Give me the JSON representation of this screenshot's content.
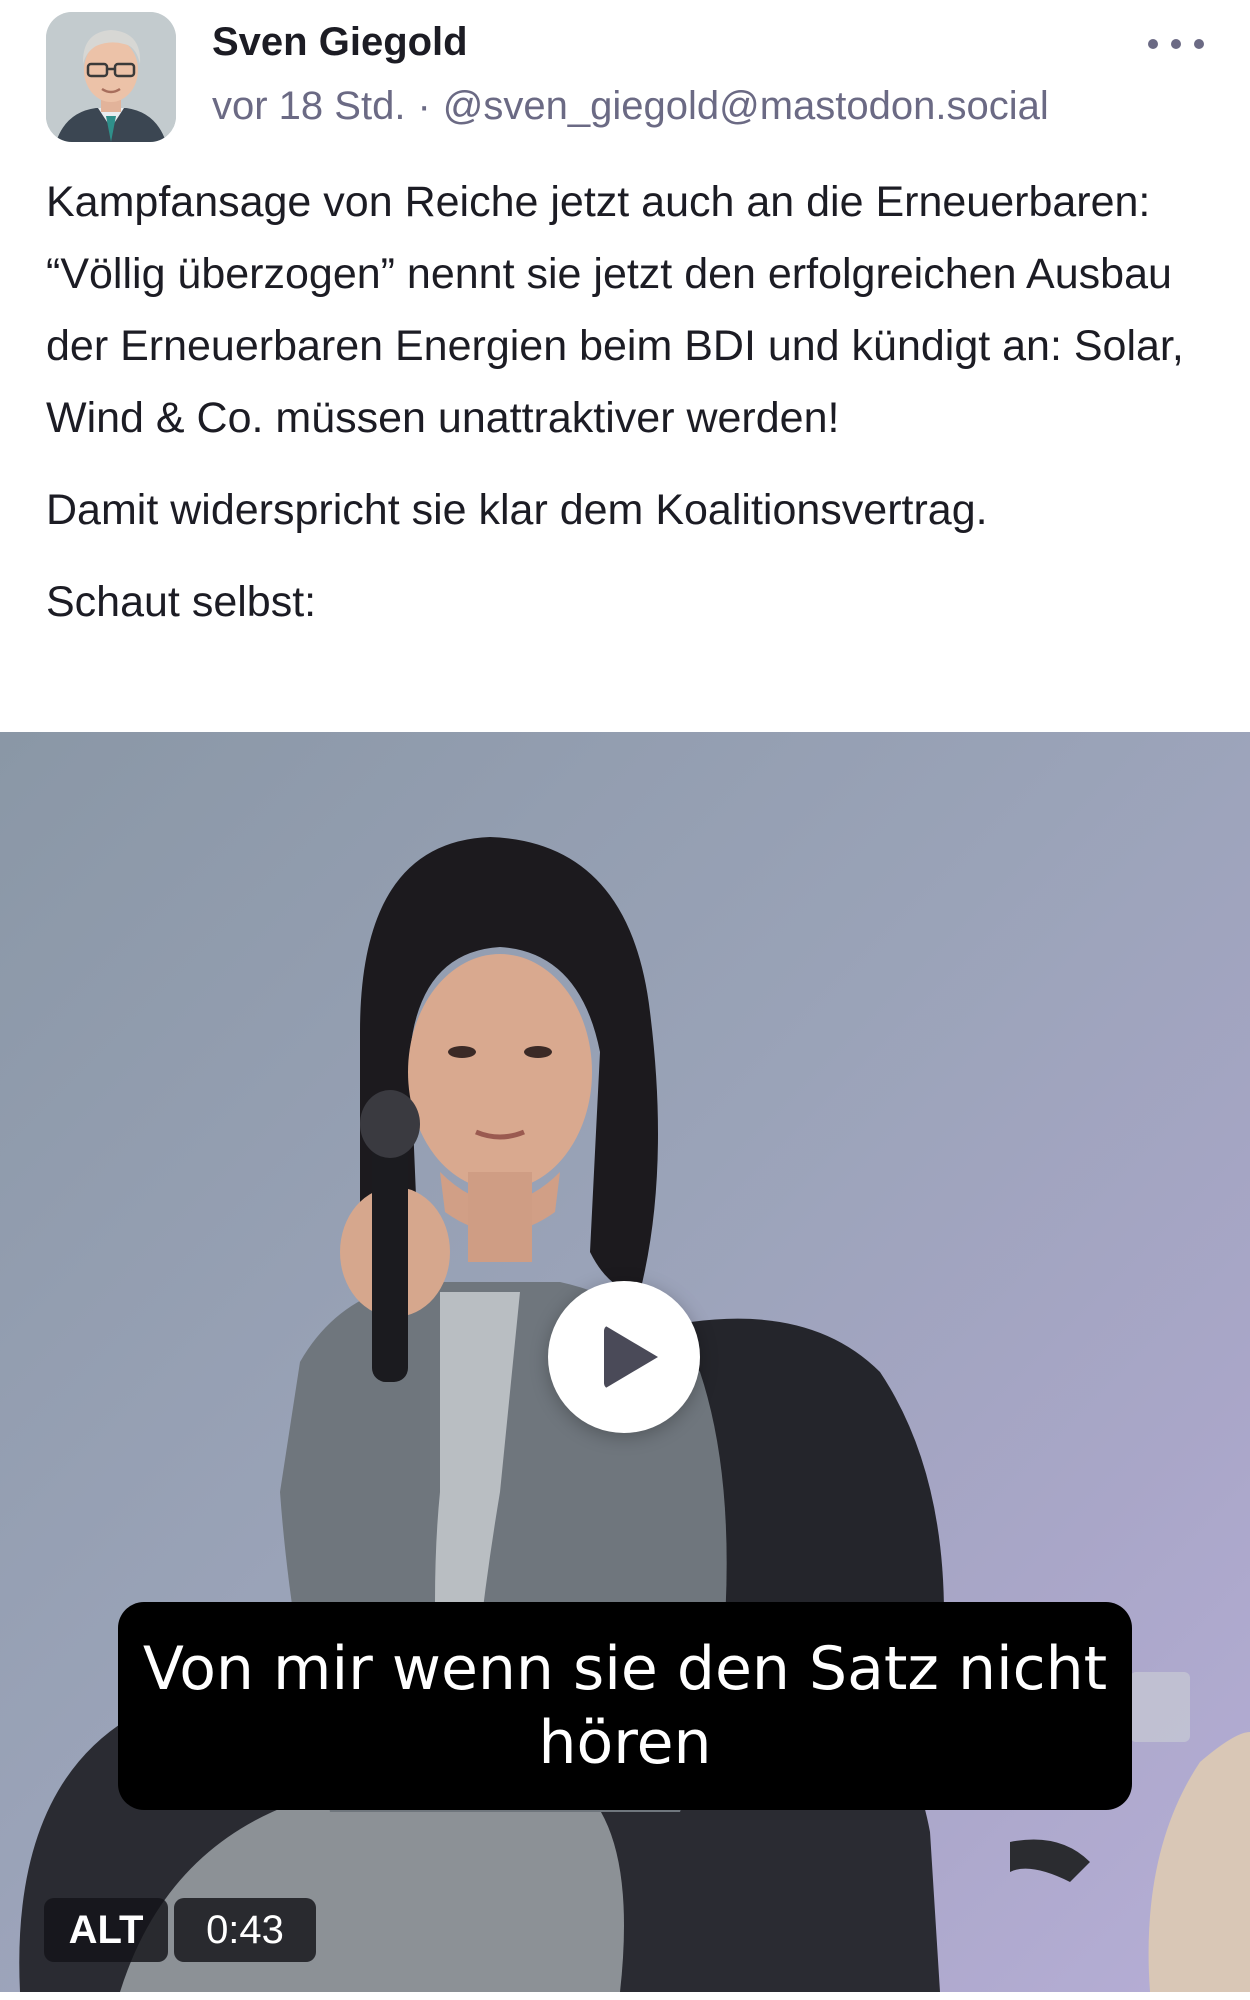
{
  "post": {
    "author": {
      "name": "Sven Giegold",
      "time": "vor 18 Std.",
      "separator": "·",
      "handle": "@sven_giegold@mastodon.social"
    },
    "paragraphs": [
      "Kampfansage von Reiche jetzt auch an die Erneuerbaren: “Völlig überzogen” nennt sie jetzt den erfolgreichen Ausbau der Erneuerbaren Energien beim BDI und kündigt an: Solar, Wind & Co. müssen unattraktiver werden!",
      "Damit widerspricht sie klar dem Koalitionsvertrag.",
      "Schaut selbst:"
    ],
    "video": {
      "subtitle": "Von mir wenn sie den Satz nicht hören",
      "alt_badge": "ALT",
      "duration": "0:43"
    }
  },
  "icons": {
    "more": "more-horizontal-icon",
    "play": "play-icon"
  },
  "colors": {
    "text": "#1c1c24",
    "meta": "#6b6a84",
    "subtitle_bg": "#000000",
    "play_bg": "#ffffff"
  }
}
